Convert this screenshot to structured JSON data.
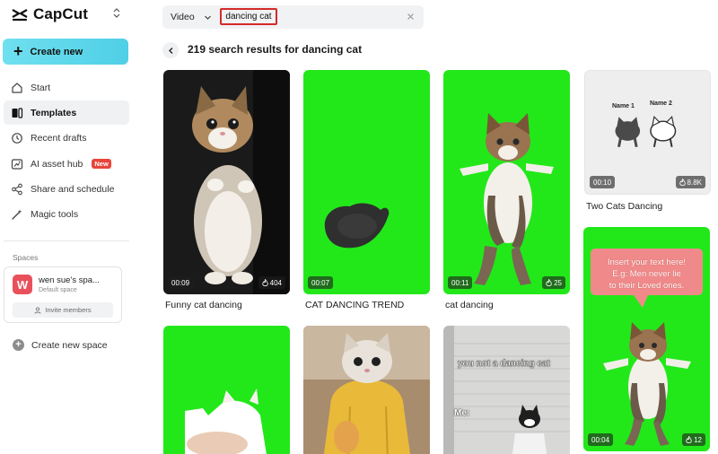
{
  "app": {
    "name": "CapCut"
  },
  "sidebar": {
    "create_label": "Create new",
    "items": [
      {
        "label": "Start",
        "icon": "home-icon"
      },
      {
        "label": "Templates",
        "icon": "templates-icon",
        "active": true
      },
      {
        "label": "Recent drafts",
        "icon": "clock-icon"
      },
      {
        "label": "AI asset hub",
        "icon": "ai-image-icon",
        "badge": "New"
      },
      {
        "label": "Share and schedule",
        "icon": "share-icon"
      },
      {
        "label": "Magic tools",
        "icon": "magic-wand-icon"
      }
    ],
    "spaces_label": "Spaces",
    "space": {
      "avatar_letter": "W",
      "name": "wen sue’s spa...",
      "subtitle": "Default space",
      "invite_label": "Invite members"
    },
    "create_space_label": "Create new space"
  },
  "search": {
    "type_value": "Video",
    "query": "dancing cat"
  },
  "results": {
    "title": "219 search results for dancing cat"
  },
  "cards": [
    {
      "title": "Funny cat dancing",
      "duration": "00:09",
      "likes": "404"
    },
    {
      "title": "CAT DANCING TREND",
      "duration": "00:07"
    },
    {
      "title": "cat dancing",
      "duration": "00:11",
      "likes": "25"
    },
    {
      "title": "Two Cats Dancing",
      "duration": "00:10",
      "likes": "8.8K",
      "overlay_texts": [
        "Name 1",
        "Name 2"
      ]
    },
    {
      "title": "",
      "duration": "",
      "likes": ""
    },
    {
      "title": "",
      "duration": "",
      "likes": ""
    },
    {
      "title": "",
      "overlay_texts": [
        "you not a dancing cat",
        "Me:"
      ]
    },
    {
      "title": "",
      "duration": "00:04",
      "likes": "12",
      "overlay_texts": [
        "Insert your text here!",
        "E.g: Men never lie",
        "to their Loved ones."
      ]
    }
  ],
  "colors": {
    "accent": "#4fcfe6",
    "green_screen": "#22e81a",
    "badge_red": "#e8453c",
    "highlight_red": "#d42a2a"
  }
}
